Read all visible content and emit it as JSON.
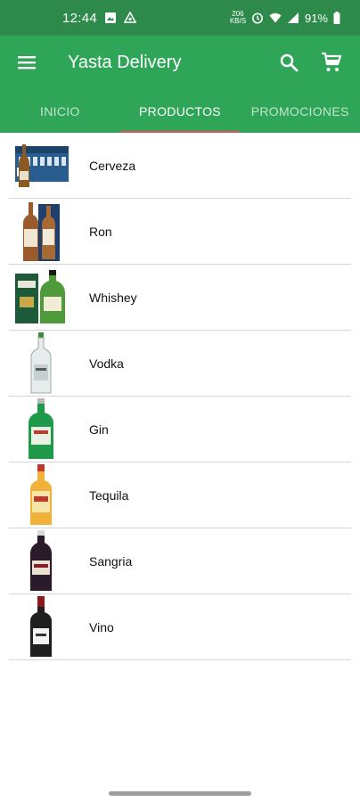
{
  "status": {
    "time": "12:44",
    "net_top": "206",
    "net_bottom": "KB/S",
    "battery": "91%"
  },
  "appbar": {
    "title": "Yasta Delivery",
    "icons": [
      "menu-icon",
      "search-icon",
      "cart-icon"
    ]
  },
  "tabs": [
    {
      "label": "INICIO",
      "active": false
    },
    {
      "label": "PRODUCTOS",
      "active": true
    },
    {
      "label": "PROMOCIONES",
      "active": false
    }
  ],
  "products": [
    {
      "name": "Cerveza",
      "icon": "beer-case-icon"
    },
    {
      "name": "Ron",
      "icon": "rum-bottles-icon"
    },
    {
      "name": "Whishey",
      "icon": "whisky-bottle-icon"
    },
    {
      "name": "Vodka",
      "icon": "vodka-bottle-icon"
    },
    {
      "name": "Gin",
      "icon": "gin-bottle-icon"
    },
    {
      "name": "Tequila",
      "icon": "tequila-bottle-icon"
    },
    {
      "name": "Sangria",
      "icon": "sangria-bottle-icon"
    },
    {
      "name": "Vino",
      "icon": "wine-bottle-icon"
    }
  ],
  "colors": {
    "statusbar": "#2d8a4b",
    "primary": "#2fa557",
    "tab_indicator": "#e74c5c"
  }
}
